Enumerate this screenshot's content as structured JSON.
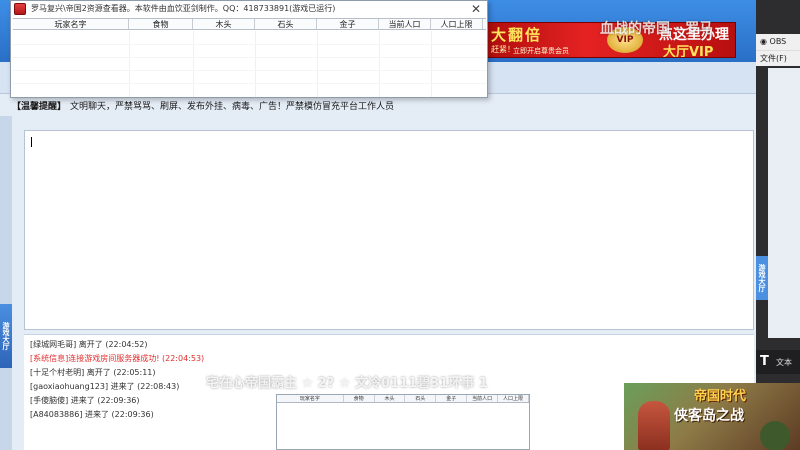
{
  "viewer": {
    "title": "罗马复兴\\帝国2资源查看器。本软件由血饮亚剑制作。QQ：418733891(游戏已运行)",
    "columns": [
      "玩家名字",
      "食物",
      "木头",
      "石头",
      "金子",
      "当前人口",
      "人口上限"
    ]
  },
  "banner": {
    "left_big": "大翻倍",
    "left_small": "赶紧！",
    "sub": "立即开启尊贵会员",
    "mid": "VIP",
    "right_top": "点这里办理",
    "right_bottom": "大厅VIP"
  },
  "overlay_top": "血战的帝国 · 罗马",
  "notice": {
    "tag": "【温馨提醒】",
    "text": "文明聊天，严禁骂骂、刷屏、发布外挂、病毒、广告！严禁模仿冒充平台工作人员"
  },
  "left_tab": "游戏大厅",
  "log": [
    {
      "text": "[绿城网毛哥] 离开了 (22:04:52)",
      "system": false
    },
    {
      "text": "[系统信息]连接游戏房间服务器成功! (22:04:53)",
      "system": true
    },
    {
      "text": "[十足个村老明] 离开了 (22:05:11)",
      "system": false
    },
    {
      "text": "[gaoxiaohuang123] 进来了 (22:08:43)",
      "system": false
    },
    {
      "text": "[手傻脑傻] 进来了 (22:09:36)",
      "system": false
    },
    {
      "text": "[A84083886] 进来了 (22:09:36)",
      "system": false
    }
  ],
  "overlay_mid": "宅在心帝国霸主 ☆ 2? ☆ 文冷0111碧31环事 1",
  "small_table": {
    "columns": [
      "玩家名字",
      "食物",
      "木头",
      "石头",
      "金子",
      "当前人口",
      "人口上限"
    ]
  },
  "obs": {
    "title": "OBS",
    "menu": "文件(F)",
    "side_tab": "游戏大厅",
    "text_source": "文本"
  },
  "promo": {
    "title": "帝国时代",
    "subtitle": "侠客岛之战"
  }
}
